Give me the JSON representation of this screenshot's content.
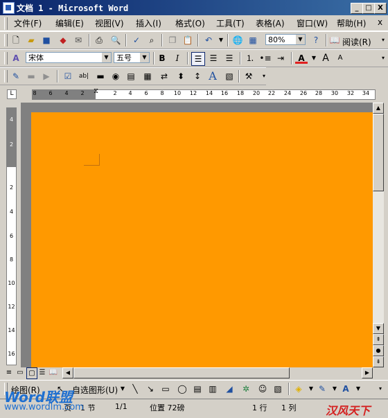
{
  "window": {
    "title": "文档 1 - Microsoft Word",
    "min_label": "_",
    "max_label": "□",
    "close_label": "X"
  },
  "menu": {
    "items": [
      "文件(F)",
      "编辑(E)",
      "视图(V)",
      "插入(I)",
      "格式(O)",
      "工具(T)",
      "表格(A)",
      "窗口(W)",
      "帮助(H)"
    ],
    "close_doc": "x"
  },
  "standard_toolbar": {
    "zoom": "80%",
    "read_label": "阅读(R)"
  },
  "format_toolbar": {
    "font": "宋体",
    "size": "五号",
    "bold": "B",
    "italic": "I",
    "font_color_label": "A",
    "grow_font": "A",
    "shrink_font": "A"
  },
  "forms_toolbar": {
    "text_label": "A"
  },
  "ruler": {
    "h_ticks": [
      "8",
      "6",
      "4",
      "2",
      "2",
      "4",
      "6",
      "8",
      "10",
      "12",
      "14",
      "16",
      "18",
      "20",
      "22",
      "24",
      "26",
      "28",
      "30",
      "32",
      "34"
    ],
    "v_ticks": [
      "4",
      "2",
      "2",
      "4",
      "6",
      "8",
      "10",
      "12",
      "14",
      "16"
    ]
  },
  "draw_toolbar": {
    "draw_label": "绘图(R)",
    "autoshape_label": "自选图形(U)",
    "text_label": "A"
  },
  "status": {
    "page": "页",
    "section": "1 节",
    "pages": "1/1",
    "position": "位置 72磅",
    "line": "1 行",
    "column": "1 列"
  },
  "watermark": {
    "brand_left": "Word联盟",
    "url_left": "www.wordlm.com",
    "brand_right": "汉风天下"
  },
  "colors": {
    "page": "#ff9900",
    "title_start": "#0a246a",
    "title_end": "#3a6ea5",
    "chrome": "#d4d0c8"
  }
}
